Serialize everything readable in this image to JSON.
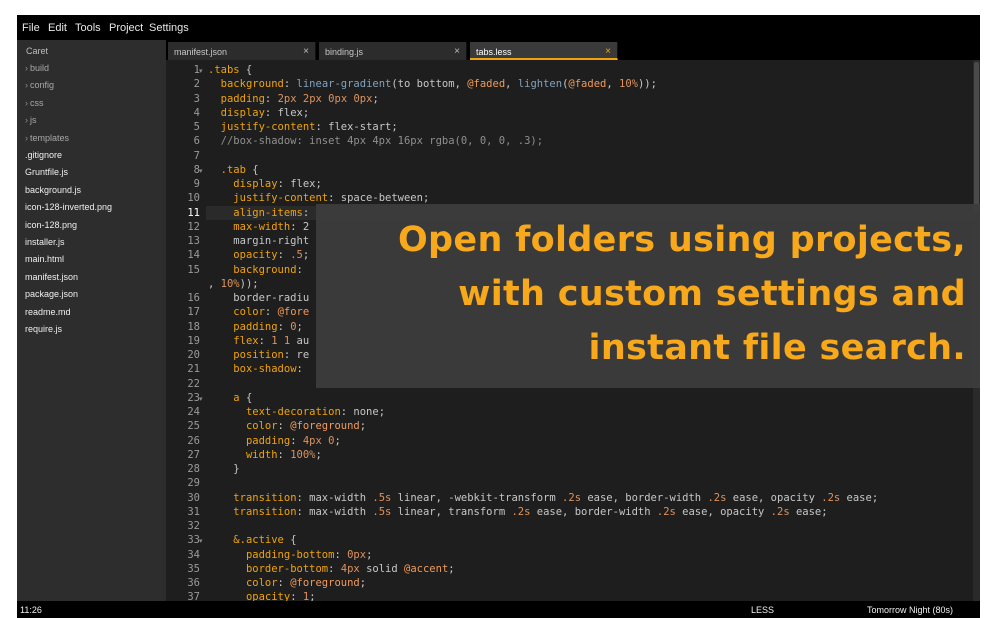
{
  "menu": [
    "File",
    "Edit",
    "Tools",
    "Project",
    "Settings"
  ],
  "sidebar": {
    "title": "Caret",
    "items": [
      {
        "label": "build",
        "type": "dir"
      },
      {
        "label": "config",
        "type": "dir"
      },
      {
        "label": "css",
        "type": "dir"
      },
      {
        "label": "js",
        "type": "dir"
      },
      {
        "label": "templates",
        "type": "dir"
      },
      {
        "label": ".gitignore",
        "type": "file"
      },
      {
        "label": "Gruntfile.js",
        "type": "file"
      },
      {
        "label": "background.js",
        "type": "file"
      },
      {
        "label": "icon-128-inverted.png",
        "type": "file"
      },
      {
        "label": "icon-128.png",
        "type": "file"
      },
      {
        "label": "installer.js",
        "type": "file"
      },
      {
        "label": "main.html",
        "type": "file"
      },
      {
        "label": "manifest.json",
        "type": "file"
      },
      {
        "label": "package.json",
        "type": "file"
      },
      {
        "label": "readme.md",
        "type": "file"
      },
      {
        "label": "require.js",
        "type": "file"
      }
    ]
  },
  "tabs": [
    {
      "label": "manifest.json",
      "close": "×",
      "active": false
    },
    {
      "label": "binding.js",
      "close": "×",
      "active": false
    },
    {
      "label": "tabs.less",
      "close": "×",
      "active": true
    }
  ],
  "editor": {
    "current_line": "11",
    "lines": [
      {
        "n": "1",
        "fold": "▾",
        "code": ".tabs {"
      },
      {
        "n": "2",
        "code": "  background: linear-gradient(to bottom, @faded, lighten(@faded, 10%));"
      },
      {
        "n": "3",
        "code": "  padding: 2px 2px 0px 0px;"
      },
      {
        "n": "4",
        "code": "  display: flex;"
      },
      {
        "n": "5",
        "code": "  justify-content: flex-start;"
      },
      {
        "n": "6",
        "code": "  //box-shadow: inset 4px 4px 16px rgba(0, 0, 0, .3);"
      },
      {
        "n": "7",
        "code": ""
      },
      {
        "n": "8",
        "fold": "▾",
        "code": "  .tab {"
      },
      {
        "n": "9",
        "code": "    display: flex;"
      },
      {
        "n": "10",
        "code": "    justify-content: space-between;"
      },
      {
        "n": "11",
        "code": "    align-items: "
      },
      {
        "n": "12",
        "code": "    max-width: 2"
      },
      {
        "n": "13",
        "code": "    margin-right"
      },
      {
        "n": "14",
        "code": "    opacity: .5;"
      },
      {
        "n": "15",
        "code": "    background: "
      },
      {
        "n": "",
        "code": ", 10%));"
      },
      {
        "n": "16",
        "code": "    border-radiu"
      },
      {
        "n": "17",
        "code": "    color: @fore"
      },
      {
        "n": "18",
        "code": "    padding: 0;"
      },
      {
        "n": "19",
        "code": "    flex: 1 1 au"
      },
      {
        "n": "20",
        "code": "    position: re"
      },
      {
        "n": "21",
        "code": "    box-shadow: "
      },
      {
        "n": "22",
        "code": ""
      },
      {
        "n": "23",
        "fold": "▾",
        "code": "    a {"
      },
      {
        "n": "24",
        "code": "      text-decoration: none;"
      },
      {
        "n": "25",
        "code": "      color: @foreground;"
      },
      {
        "n": "26",
        "code": "      padding: 4px 0;"
      },
      {
        "n": "27",
        "code": "      width: 100%;"
      },
      {
        "n": "28",
        "code": "    }"
      },
      {
        "n": "29",
        "code": ""
      },
      {
        "n": "30",
        "code": "    transition: max-width .5s linear, -webkit-transform .2s ease, border-width .2s ease, opacity .2s ease;"
      },
      {
        "n": "31",
        "code": "    transition: max-width .5s linear, transform .2s ease, border-width .2s ease, opacity .2s ease;"
      },
      {
        "n": "32",
        "code": ""
      },
      {
        "n": "33",
        "fold": "▾",
        "code": "    &.active {"
      },
      {
        "n": "34",
        "code": "      padding-bottom: 0px;"
      },
      {
        "n": "35",
        "code": "      border-bottom: 4px solid @accent;"
      },
      {
        "n": "36",
        "code": "      color: @foreground;"
      },
      {
        "n": "37",
        "code": "      opacity: 1;"
      }
    ]
  },
  "overlay": {
    "lines": [
      "Open folders using projects,",
      "with custom settings and",
      "instant file search."
    ]
  },
  "status": {
    "time": "11:26",
    "mode": "LESS",
    "theme": "Tomorrow Night (80s)"
  },
  "colors": {
    "accent": "#f0a30a",
    "overlay_text": "#f7a81b"
  }
}
